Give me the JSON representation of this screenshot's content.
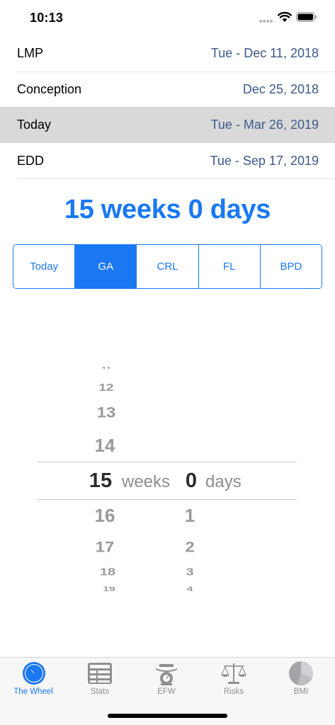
{
  "status_bar": {
    "time": "10:13"
  },
  "dates": [
    {
      "label": "LMP",
      "value": "Tue - Dec 11, 2018",
      "selected": false
    },
    {
      "label": "Conception",
      "value": "Dec 25, 2018",
      "selected": false
    },
    {
      "label": "Today",
      "value": "Tue - Mar 26, 2019",
      "selected": true
    },
    {
      "label": "EDD",
      "value": "Tue - Sep 17, 2019",
      "selected": false
    }
  ],
  "gestational_age": "15 weeks 0 days",
  "segments": [
    {
      "label": "Today",
      "active": false
    },
    {
      "label": "GA",
      "active": true
    },
    {
      "label": "CRL",
      "active": false
    },
    {
      "label": "FL",
      "active": false
    },
    {
      "label": "BPD",
      "active": false
    }
  ],
  "picker": {
    "weeks_above": [
      "11",
      "12",
      "13",
      "14"
    ],
    "weeks_selected": "15",
    "weeks_below": [
      "16",
      "17",
      "18",
      "19"
    ],
    "weeks_unit": "weeks",
    "days_selected": "0",
    "days_below": [
      "1",
      "2",
      "3",
      "4"
    ],
    "days_unit": "days"
  },
  "tabs": [
    {
      "label": "The Wheel",
      "icon": "wheel-icon",
      "active": true
    },
    {
      "label": "Stats",
      "icon": "stats-icon",
      "active": false
    },
    {
      "label": "EFW",
      "icon": "scale-icon",
      "active": false
    },
    {
      "label": "Risks",
      "icon": "balance-icon",
      "active": false
    },
    {
      "label": "BMI",
      "icon": "pie-icon",
      "active": false
    }
  ],
  "colors": {
    "accent": "#1a78f2",
    "date_value": "#3c5a8a",
    "selected_row": "#d9d9d9"
  }
}
